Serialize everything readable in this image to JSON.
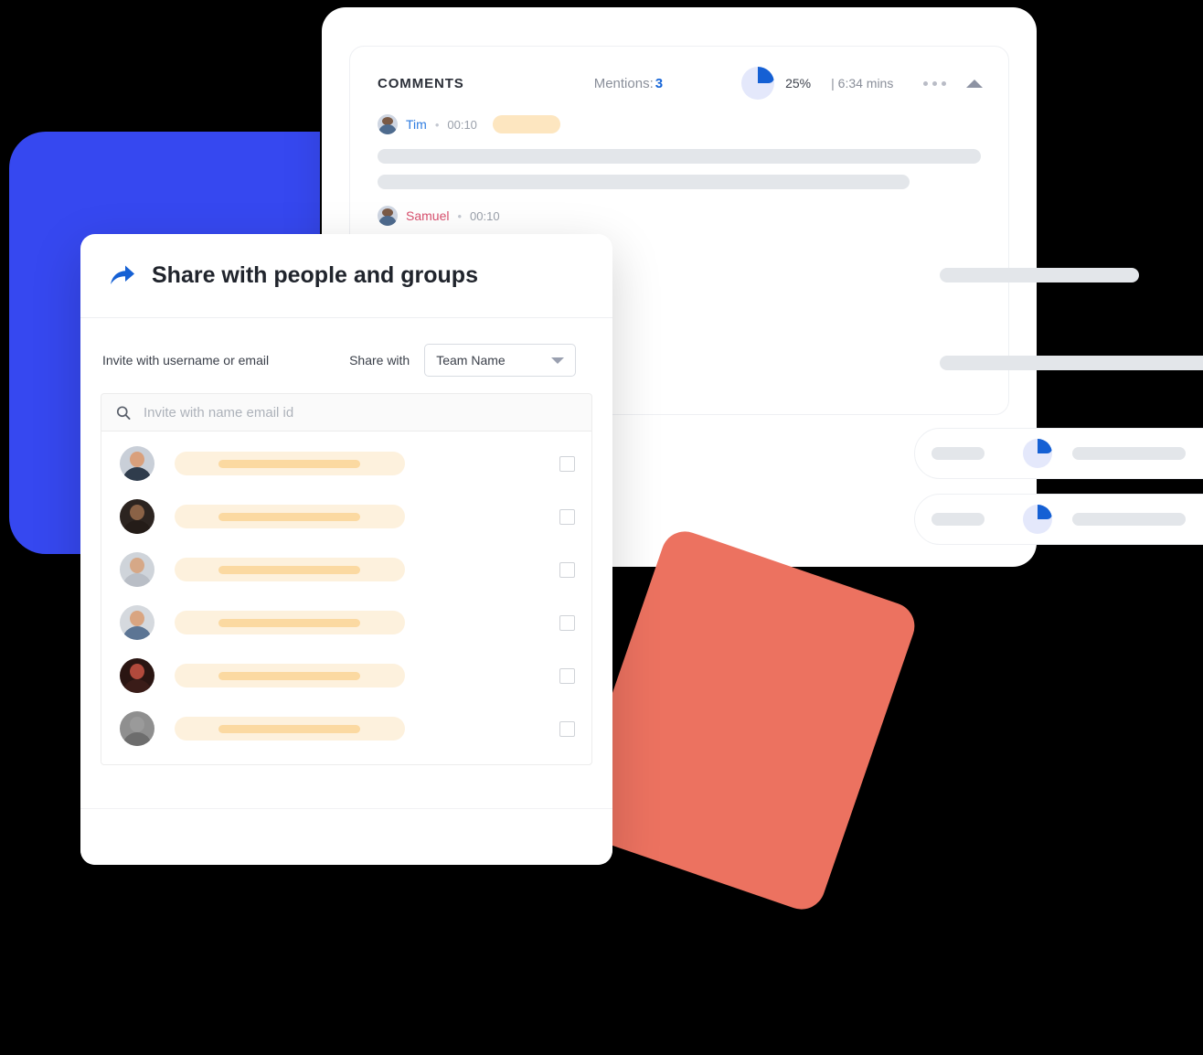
{
  "background": {
    "blue_shape_color": "#3648f0",
    "coral_shape_color": "#ec7260",
    "page_color": "#000000"
  },
  "comments_panel": {
    "title": "COMMENTS",
    "mentions_label": "Mentions:",
    "mentions_count": "3",
    "progress_percent": "25%",
    "duration": "| 6:34 mins",
    "accent_blue": "#1560d4",
    "more_icon": "more-horizontal-icon",
    "collapse_icon": "caret-up-icon",
    "comments": [
      {
        "name": "Tim",
        "separator": "•",
        "time": "00:10",
        "name_color": "#2f7ce0"
      },
      {
        "name": "Samuel",
        "separator": "•",
        "time": "00:10",
        "name_color": "#d9516f"
      }
    ],
    "task_rows": [
      {
        "progress_percent": "25%"
      },
      {
        "progress_percent": "25%"
      }
    ]
  },
  "share_dialog": {
    "icon": "share-arrow-icon",
    "title": "Share with people and groups",
    "invite_label": "Invite with username or email",
    "share_with_label": "Share with",
    "team_select": {
      "value": "Team Name",
      "caret_icon": "caret-down-icon"
    },
    "search": {
      "icon": "search-icon",
      "value": "",
      "placeholder": "Invite with name email id"
    },
    "people": [
      {
        "avatar": "avatar-person-1",
        "skin": "#d9a07c",
        "hair": "#3b2a20",
        "shirt": "#2f3c4c",
        "bg": "#c9cfd8",
        "checked": false
      },
      {
        "avatar": "avatar-person-2",
        "skin": "#8a6246",
        "hair": "#1d1714",
        "shirt": "#241c18",
        "bg": "#2c2420",
        "checked": false
      },
      {
        "avatar": "avatar-person-3",
        "skin": "#d6a887",
        "hair": "#2c2420",
        "shirt": "#b9bec6",
        "bg": "#cfd4da",
        "checked": false
      },
      {
        "avatar": "avatar-person-4",
        "skin": "#d9a581",
        "hair": "#2e231c",
        "shirt": "#5c7594",
        "bg": "#d5d9de",
        "checked": false
      },
      {
        "avatar": "avatar-person-5",
        "skin": "#b24a3c",
        "hair": "#241512",
        "shirt": "#3a1c18",
        "bg": "#2a1512",
        "checked": false
      },
      {
        "avatar": "avatar-person-6",
        "skin": "#9a9a9a",
        "hair": "#4a4a4a",
        "shirt": "#6d6d6d",
        "bg": "#8f8f8f",
        "checked": false
      }
    ]
  }
}
